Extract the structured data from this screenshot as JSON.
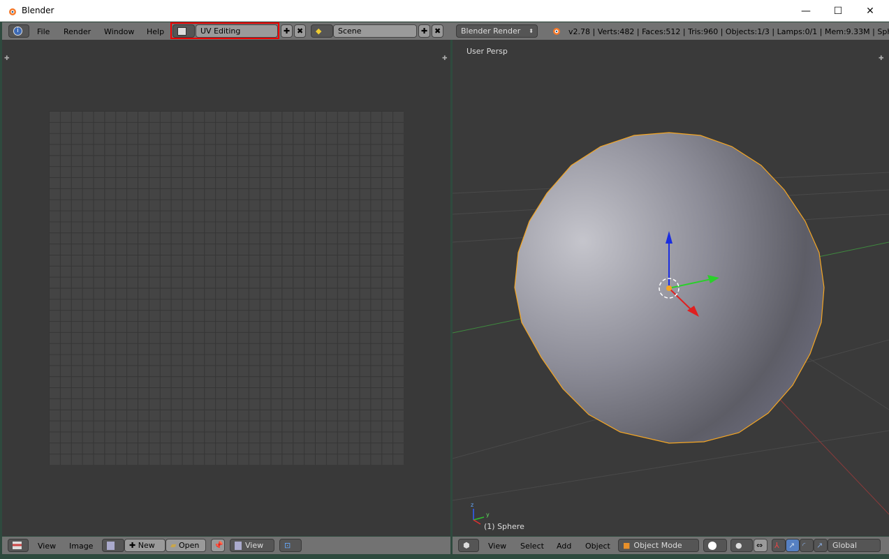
{
  "window": {
    "title": "Blender",
    "minimize": "—",
    "maximize": "☐",
    "close": "✕"
  },
  "info_header": {
    "menus": [
      "File",
      "Render",
      "Window",
      "Help"
    ],
    "screen_layout": "UV Editing",
    "scene": "Scene",
    "render_engine": "Blender Render",
    "stats": "v2.78 | Verts:482 | Faces:512 | Tris:960 | Objects:1/3 | Lamps:0/1 | Mem:9.33M | Sphe"
  },
  "uv_editor": {
    "menus": [
      "View",
      "Image"
    ],
    "new_label": "New",
    "open_label": "Open",
    "view_label": "View"
  },
  "viewport": {
    "view_label": "User Persp",
    "object_label": "(1) Sphere",
    "menus": [
      "View",
      "Select",
      "Add",
      "Object"
    ],
    "mode": "Object Mode",
    "orientation": "Global",
    "axis_labels": {
      "x": "x",
      "y": "y",
      "z": "z"
    }
  },
  "colors": {
    "highlight": "#ff0000",
    "selection": "#f5a623",
    "accent": "#5680c2"
  }
}
